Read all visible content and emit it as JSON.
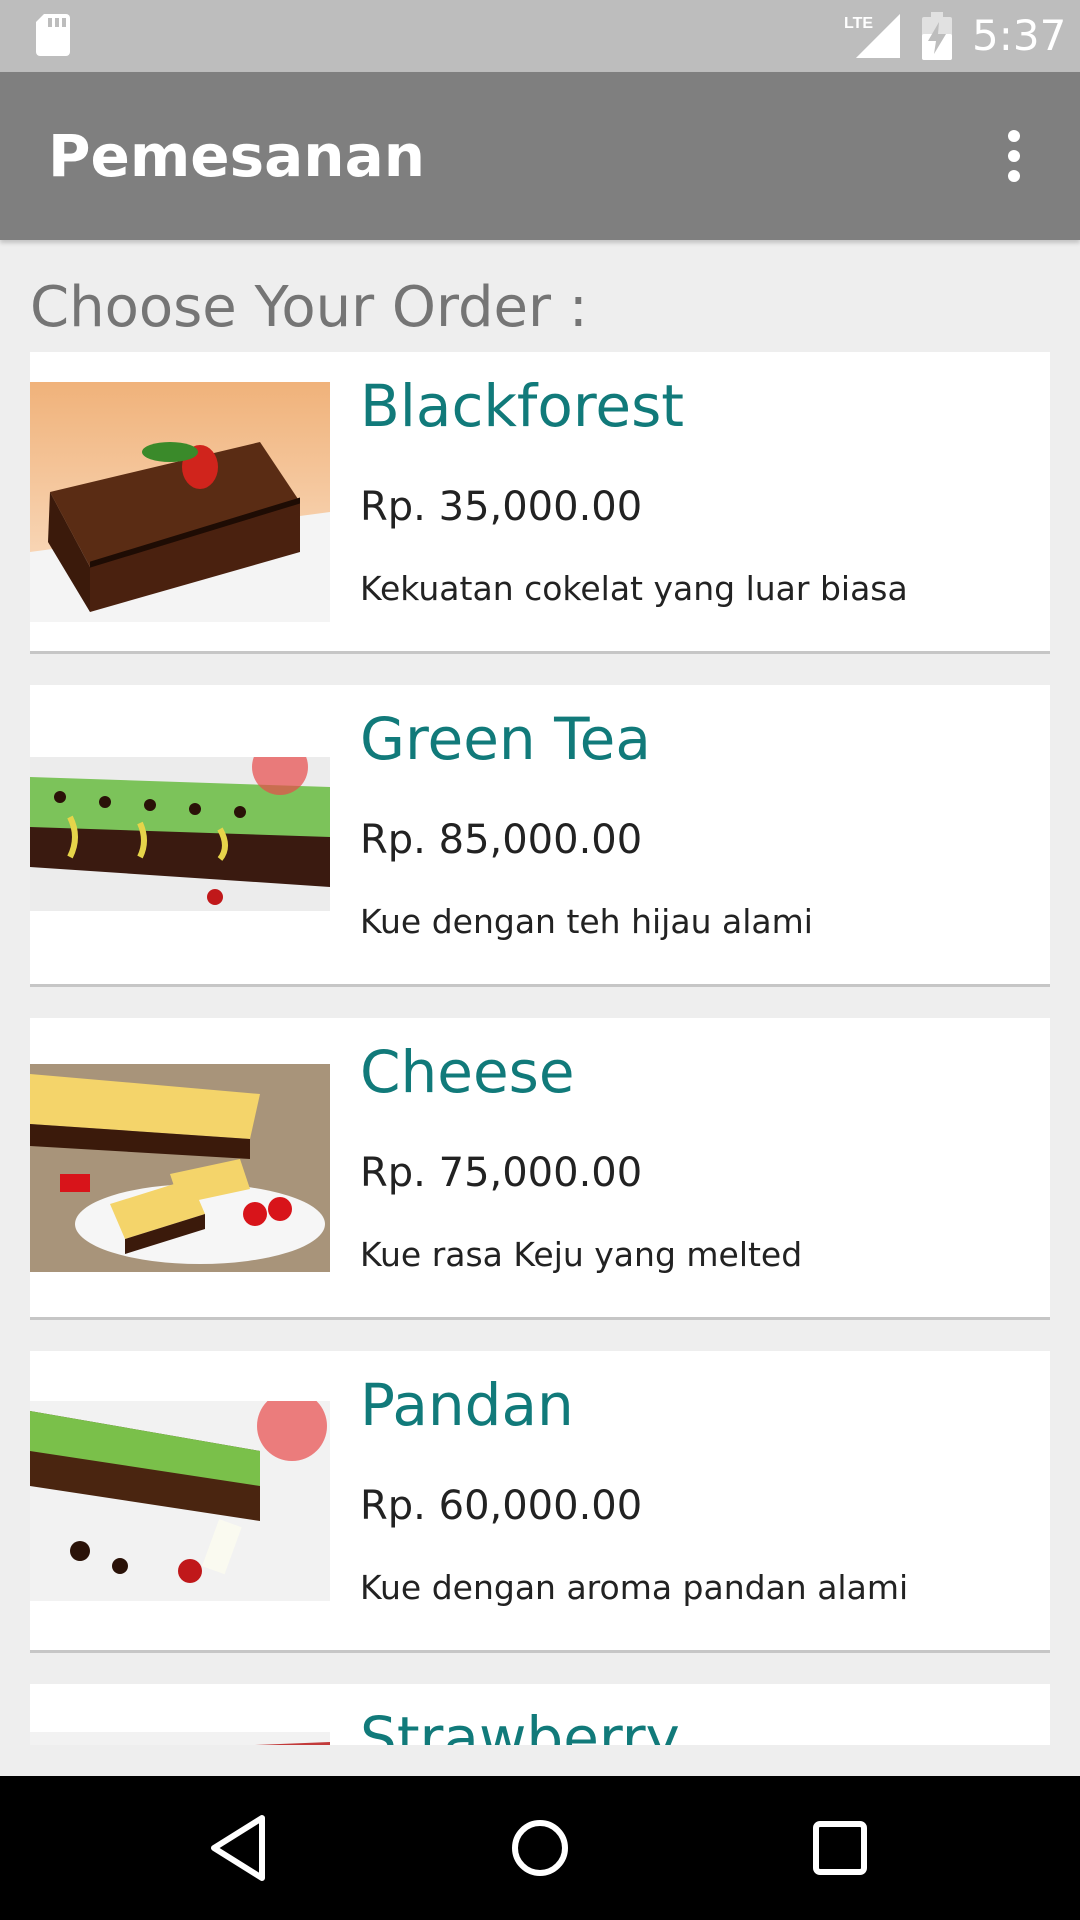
{
  "status_bar": {
    "time": "5:37",
    "network_label": "LTE",
    "icons": [
      "sd-card-icon",
      "lte-signal-icon",
      "battery-charging-icon"
    ]
  },
  "app_bar": {
    "title": "Pemesanan",
    "overflow_icon": "more-vert-icon"
  },
  "content": {
    "heading": "Choose Your Order :",
    "items": [
      {
        "name": "Blackforest",
        "price": "Rp. 35,000.00",
        "description": "Kekuatan cokelat yang luar biasa",
        "image": "chocolate-cake-image"
      },
      {
        "name": "Green Tea",
        "price": "Rp. 85,000.00",
        "description": "Kue dengan teh hijau alami",
        "image": "green-tea-cake-image"
      },
      {
        "name": "Cheese",
        "price": "Rp. 75,000.00",
        "description": "Kue rasa Keju yang melted",
        "image": "cheese-cake-image"
      },
      {
        "name": "Pandan",
        "price": "Rp. 60,000.00",
        "description": "Kue dengan aroma pandan alami",
        "image": "pandan-cake-image"
      },
      {
        "name": "Strawberry",
        "price": "",
        "description": "",
        "image": "strawberry-cake-image"
      }
    ]
  },
  "nav_bar": {
    "icons": [
      "back-icon",
      "home-icon",
      "recents-icon"
    ]
  },
  "colors": {
    "status_bar": "#bdbdbd",
    "app_bar": "#7f7f7f",
    "item_title": "#117a7a",
    "background": "#eeeeee"
  }
}
